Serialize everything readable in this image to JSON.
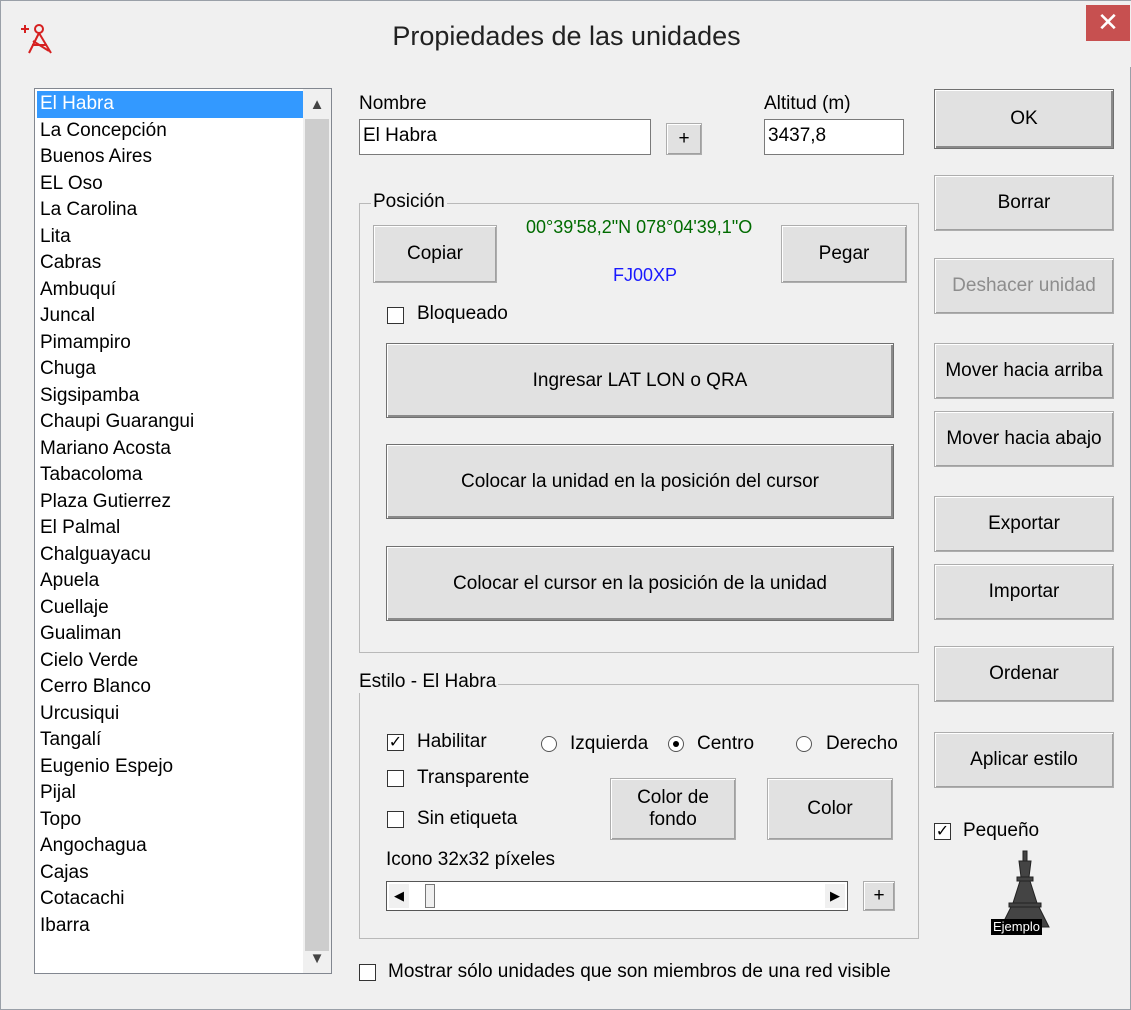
{
  "window": {
    "title": "Propiedades de las unidades",
    "close_label": "✕"
  },
  "units": {
    "items": [
      "El Habra",
      "La Concepción",
      "Buenos Aires",
      "EL Oso",
      "La Carolina",
      "Lita",
      "Cabras",
      "Ambuquí",
      "Juncal",
      "Pimampiro",
      "Chuga",
      "Sigsipamba",
      "Chaupi Guarangui",
      "Mariano Acosta",
      "Tabacoloma",
      "Plaza Gutierrez",
      "El Palmal",
      "Chalguayacu",
      "Apuela",
      "Cuellaje",
      "Gualiman",
      "Cielo Verde",
      "Cerro Blanco",
      "Urcusiqui",
      "Tangalí",
      "Eugenio Espejo",
      "Pijal",
      "Topo",
      "Angochagua",
      "Cajas",
      "Cotacachi",
      "Ibarra"
    ],
    "selected": "El Habra"
  },
  "form": {
    "name_label": "Nombre",
    "name_value": "El Habra",
    "name_plus": "+",
    "altitude_label": "Altitud (m)",
    "altitude_value": "3437,8"
  },
  "position": {
    "group_title": "Posición",
    "copy": "Copiar",
    "paste": "Pegar",
    "coordinates": "00°39'58,2\"N 078°04'39,1\"O",
    "qra": "FJ00XP",
    "locked_label": "Bloqueado",
    "locked": false,
    "enter_latlon": "Ingresar LAT LON o QRA",
    "place_unit": "Colocar la unidad en la posición del cursor",
    "place_cursor": "Colocar el cursor en la posición de la unidad"
  },
  "style": {
    "group_title": "Estilo - El Habra",
    "enable_label": "Habilitar",
    "enable": true,
    "left_label": "Izquierda",
    "center_label": "Centro",
    "right_label": "Derecho",
    "alignment": "Centro",
    "transparent_label": "Transparente",
    "transparent": false,
    "no_label_label": "Sin etiqueta",
    "no_label": false,
    "bg_color_line1": "Color de",
    "bg_color_line2": "fondo",
    "color": "Color",
    "icon_label": "Icono 32x32 píxeles",
    "icon_plus": "+"
  },
  "actions": {
    "ok": "OK",
    "delete": "Borrar",
    "undo": "Deshacer unidad",
    "move_up": "Mover hacia arriba",
    "move_down": "Mover hacia abajo",
    "export": "Exportar",
    "import": "Importar",
    "sort": "Ordenar",
    "apply_style": "Aplicar estilo",
    "small_label": "Pequeño",
    "small": true,
    "example_label": "Ejemplo"
  },
  "footer": {
    "show_visible_label": "Mostrar sólo unidades que son miembros de una red visible",
    "show_visible": false
  },
  "colors": {
    "selection": "#3399ff",
    "close": "#c75050",
    "coordinates": "#006b00",
    "qra": "#1a1aff"
  }
}
